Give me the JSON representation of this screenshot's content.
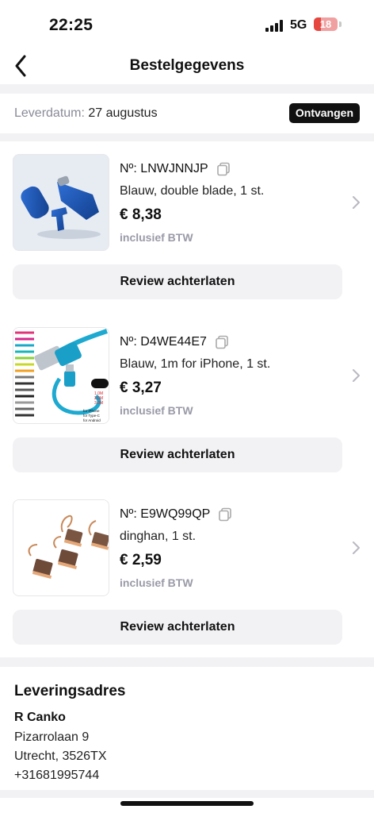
{
  "status_bar": {
    "time": "22:25",
    "network": "5G",
    "battery_level": "18"
  },
  "header": {
    "title": "Bestelgegevens",
    "back_icon": "chevron-left-icon"
  },
  "delivery": {
    "label": "Leverdatum:",
    "date": "27 augustus",
    "status": "Ontvangen"
  },
  "items": [
    {
      "sku": "Nº: LNWJNNJP",
      "variant": "Blauw, double blade, 1 st.",
      "price": "€ 8,38",
      "vat_note": "inclusief BTW",
      "review_label": "Review achterlaten"
    },
    {
      "sku": "Nº: D4WE44E7",
      "variant": "Blauw, 1m for iPhone, 1 st.",
      "price": "€ 3,27",
      "vat_note": "inclusief BTW",
      "review_label": "Review achterlaten",
      "image_labels": [
        "1.0M",
        "2.0M",
        "3.0M",
        "for iPhone",
        "for Type-C",
        "for Android"
      ]
    },
    {
      "sku": "Nº: E9WQ99QP",
      "variant": "dinghan, 1 st.",
      "price": "€ 2,59",
      "vat_note": "inclusief BTW",
      "review_label": "Review achterlaten"
    }
  ],
  "address": {
    "heading": "Leveringsadres",
    "name": "R Canko",
    "street": "Pizarrolaan 9",
    "city": "Utrecht, 3526TX",
    "phone": "+31681995744"
  },
  "colors": {
    "badge_bg": "#111111",
    "section_gap": "#f2f2f5",
    "muted_text": "#8a8a99",
    "battery_low": "#e5473f"
  }
}
